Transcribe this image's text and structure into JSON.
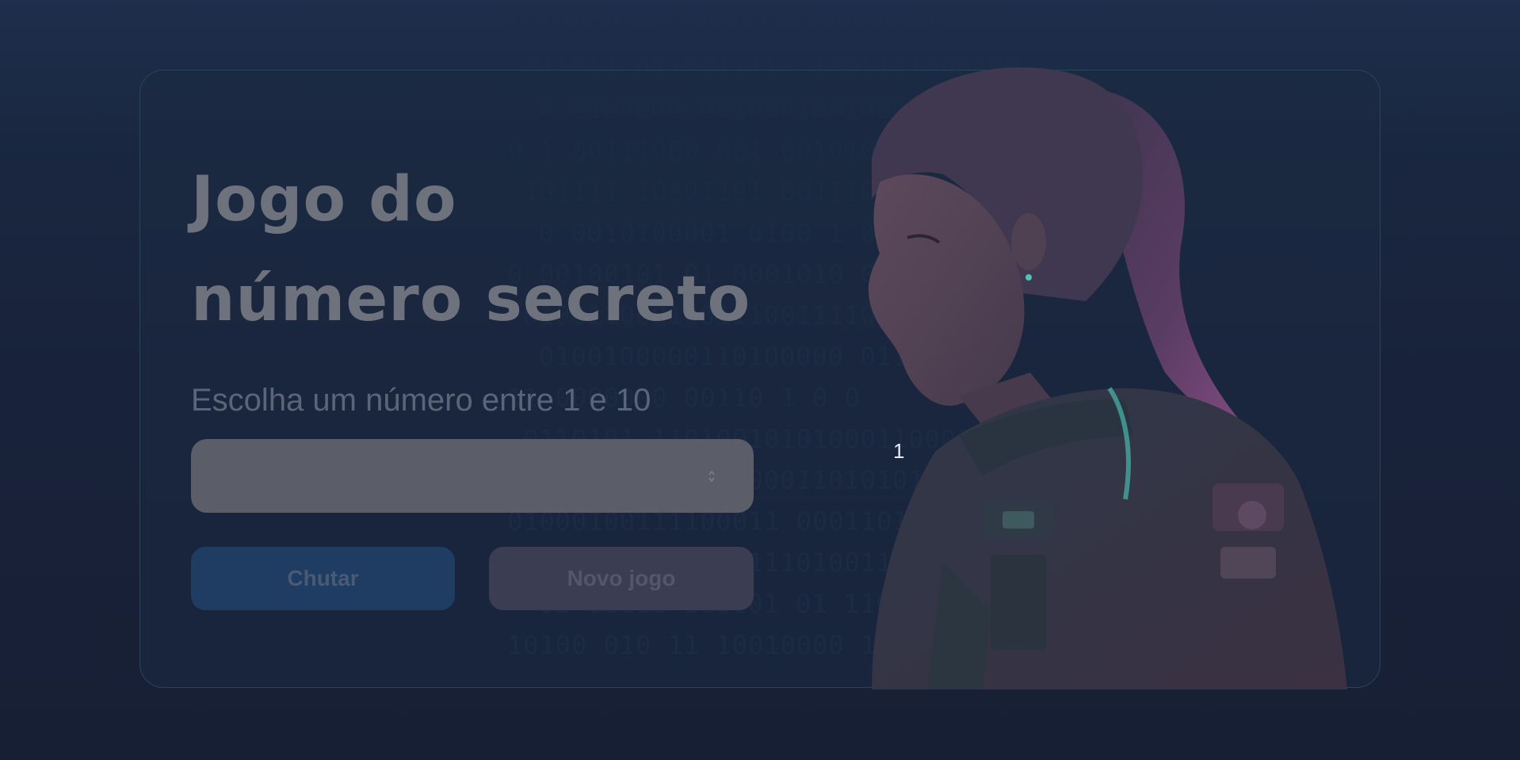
{
  "game": {
    "title": "Jogo do número secreto",
    "instruction": "Escolha um número entre 1 e 10",
    "input_value": "",
    "attempt_marker": "1"
  },
  "buttons": {
    "guess_label": "Chutar",
    "new_game_label": "Novo jogo"
  },
  "background": {
    "binary_lines": [
      "01011110  10111100  1111111  0",
      "011011 0110011111  1001111000100",
      "0  0100000 0010001001000001  0",
      "0 1 00111000  001 0010101100111",
      "   101111 10001101  0011100 0  1",
      "0   0010100001 0100  1 0 00101",
      "0 00100101 01 0001010  0000  0",
      "  010011000100111001111000  11",
      "   0100100000110100000  011001 0",
      "   11 0000000 00110  1   0  0",
      "   0110101 11010010101000110000",
      "   11 00010001 0000110101010  0",
      "  01000100111100011 0001101001 1",
      " 1010000111100011101001111  11 10",
      "02 01111   100101  01  11001",
      "  10100 010 11 10010000 101011 010"
    ]
  },
  "colors": {
    "background": "#18223a",
    "card_border": "#2a4458",
    "title": "#6e727d",
    "input_bg": "#5b5d68",
    "guess_button": "#1f3c62",
    "new_game_button": "#3b3d52",
    "hair_accent": "#8a4f86"
  },
  "icons": {
    "spinner": "number-spinner-icon",
    "illustration": "astronaut-girl-illustration"
  }
}
